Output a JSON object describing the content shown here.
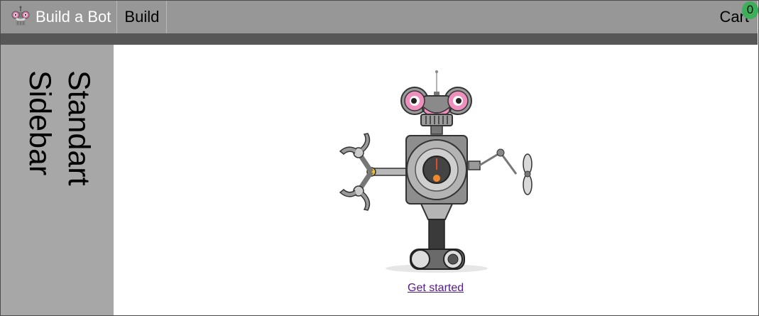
{
  "header": {
    "brand_label": "Build a Bot",
    "brand_icon": "robot-head-logo-icon",
    "nav_build_label": "Build",
    "cart_label": "Cart",
    "cart_count": "0"
  },
  "sidebar": {
    "title": "Standart Sidebar"
  },
  "main": {
    "hero_image": "robot-illustration",
    "get_started_label": "Get started"
  },
  "colors": {
    "header_bg": "#979797",
    "strip_bg": "#575757",
    "sidebar_bg": "#a7a7a7",
    "badge_bg": "#3fae5a",
    "link": "#551a8b"
  }
}
